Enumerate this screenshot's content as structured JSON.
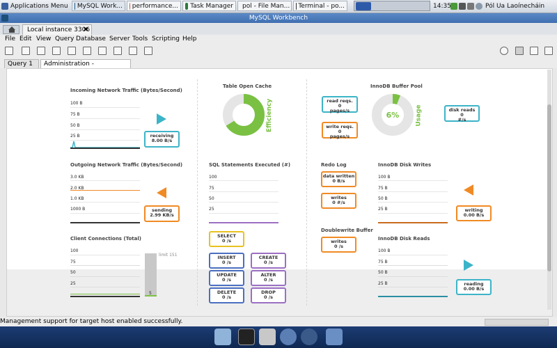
{
  "taskbar": {
    "apps_menu": "Applications Menu",
    "tasks": [
      "MySQL Work...",
      "performance...",
      "Task Manager",
      "pol - File Man...",
      "Terminal - po..."
    ],
    "time": "14:35",
    "user": "Pól Ua Laoínecháin"
  },
  "window": {
    "title": "MySQL Workbench"
  },
  "connection_tab": "Local instance 3306",
  "menu": [
    "File",
    "Edit",
    "View",
    "Query",
    "Database",
    "Server",
    "Tools",
    "Scripting",
    "Help"
  ],
  "tabs": {
    "query": "Query 1",
    "admin": "Administration - Dashboard"
  },
  "network": {
    "incoming_title": "Incoming Network Traffic (Bytes/Second)",
    "incoming_ticks": [
      "100 B",
      "75 B",
      "50 B",
      "25 B"
    ],
    "receiving_label": "receiving",
    "receiving_value": "8.00 B/s",
    "outgoing_title": "Outgoing Network Traffic (Bytes/Second)",
    "outgoing_ticks": [
      "3.0 KB",
      "2.0 KB",
      "1.0 KB",
      "1000 B"
    ],
    "sending_label": "sending",
    "sending_value": "2.99 KB/s",
    "clients_title": "Client Connections (Total)",
    "clients_ticks": [
      "100",
      "75",
      "50",
      "25"
    ],
    "clients_limit": "limit 151",
    "clients_value": "5",
    "clients_fraction": 0.033
  },
  "mysql": {
    "cache_title": "Table Open Cache",
    "cache_percent": "66%",
    "cache_fraction": 0.66,
    "cache_side": "Efficiency",
    "sql_title": "SQL Statements Executed (#)",
    "sql_ticks": [
      "100",
      "75",
      "50",
      "25"
    ],
    "select_label": "SELECT",
    "insert_label": "INSERT",
    "create_label": "CREATE",
    "update_label": "UPDATE",
    "alter_label": "ALTER",
    "delete_label": "DELETE",
    "drop_label": "DROP",
    "rate": "0 /s"
  },
  "innodb": {
    "pool_title": "InnoDB Buffer Pool",
    "read_reqs_label": "read reqs.",
    "read_reqs_value": "0",
    "write_reqs_label": "write reqs.",
    "write_reqs_value": "0",
    "pages_unit": "pages/s",
    "pool_percent": "6%",
    "pool_fraction": 0.06,
    "pool_side": "Usage",
    "disk_reads_label": "disk reads",
    "disk_reads_value": "0",
    "disk_reads_unit": "#/s",
    "redo_title": "Redo Log",
    "data_written_label": "data written",
    "data_written_value": "0 B/s",
    "redo_writes_label": "writes",
    "redo_writes_value": "0 #/s",
    "dblwr_title": "Doublewrite Buffer",
    "dblwr_writes_label": "writes",
    "dblwr_writes_value": "0 /s",
    "disk_writes_title": "InnoDB Disk Writes",
    "disk_writes_ticks": [
      "100 B",
      "75 B",
      "50 B",
      "25 B"
    ],
    "writing_label": "writing",
    "writing_value": "0.00 B/s",
    "disk_reads_title": "InnoDB Disk Reads",
    "disk_reads_ticks": [
      "100 B",
      "75 B",
      "50 B",
      "25 B"
    ],
    "reading_label": "reading",
    "reading_value": "0.00 B/s"
  },
  "status": "Management support for target host enabled successfully.",
  "colors": {
    "teal": "#3cb4c8",
    "orange": "#f08a24",
    "green": "#7ac143",
    "purple": "#9b6fc3",
    "blue": "#4a6fc1",
    "yellow": "#e8c21e"
  }
}
